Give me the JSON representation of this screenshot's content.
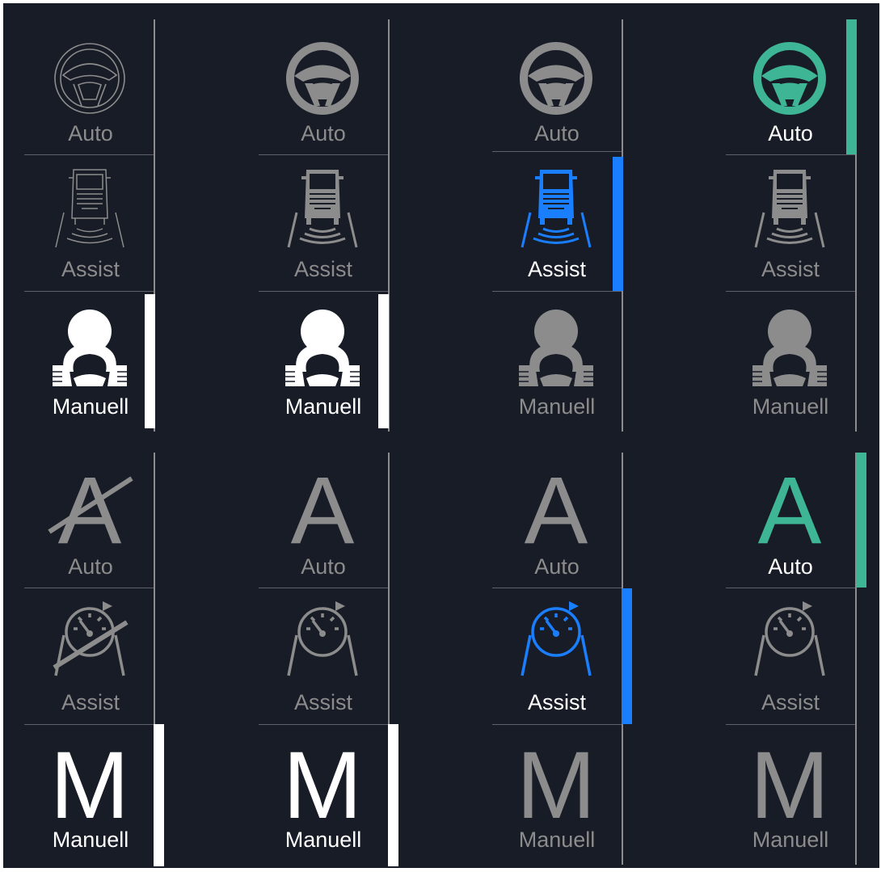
{
  "labels": {
    "auto": "Auto",
    "assist": "Assist",
    "manual": "Manuell"
  },
  "letters": {
    "auto": "A",
    "manual": "M"
  },
  "icons": {
    "auto_top": "steering-wheel-icon",
    "assist_top": "truck-lane-assist-icon",
    "manual_top": "driver-hands-on-wheel-icon",
    "auto_bottom": "letter-a-icon",
    "assist_bottom": "speedometer-lane-icon",
    "manual_bottom": "letter-m-icon"
  },
  "colors": {
    "background": "#181c26",
    "inactive": "#8c8c8c",
    "selected_white": "#ffffff",
    "assist_blue": "#1a7fff",
    "auto_green": "#3eb594"
  },
  "selectors": [
    {
      "group": "top",
      "variant": "outline-disabled",
      "selected_mode": "Manuell"
    },
    {
      "group": "top",
      "variant": "filled",
      "selected_mode": "Manuell"
    },
    {
      "group": "top",
      "variant": "filled",
      "selected_mode": "Assist"
    },
    {
      "group": "top",
      "variant": "filled",
      "selected_mode": "Auto"
    },
    {
      "group": "bottom",
      "variant": "struck-through",
      "selected_mode": "Manuell"
    },
    {
      "group": "bottom",
      "variant": "normal",
      "selected_mode": "Manuell"
    },
    {
      "group": "bottom",
      "variant": "normal",
      "selected_mode": "Assist"
    },
    {
      "group": "bottom",
      "variant": "normal",
      "selected_mode": "Auto"
    }
  ]
}
